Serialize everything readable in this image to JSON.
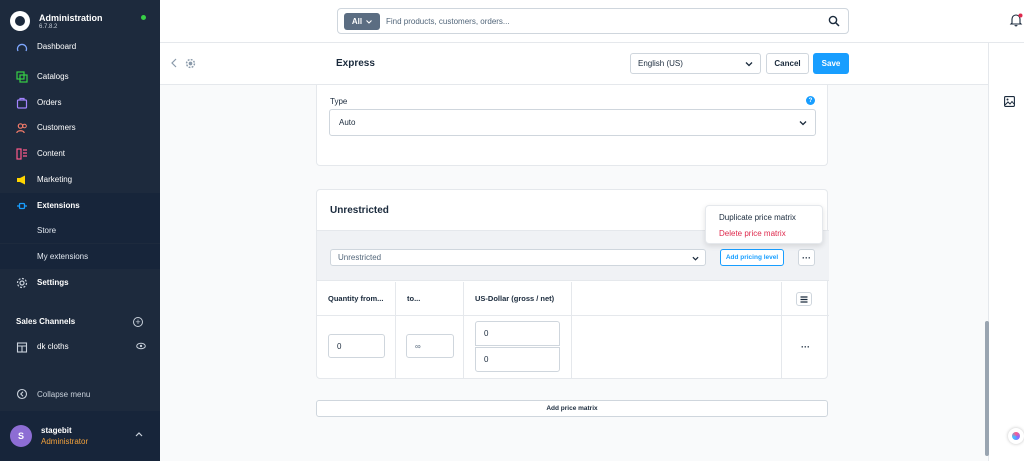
{
  "brand": {
    "name": "Administration",
    "version": "6.7.8.2"
  },
  "sidebar": {
    "items": [
      {
        "label": "Dashboard",
        "icon": "dashboard-icon"
      },
      {
        "label": "Catalogs",
        "icon": "catalog-icon"
      },
      {
        "label": "Orders",
        "icon": "orders-icon"
      },
      {
        "label": "Customers",
        "icon": "customers-icon"
      },
      {
        "label": "Content",
        "icon": "content-icon"
      },
      {
        "label": "Marketing",
        "icon": "marketing-icon"
      },
      {
        "label": "Extensions",
        "icon": "extensions-icon",
        "active": true
      },
      {
        "label": "Store"
      },
      {
        "label": "My extensions"
      },
      {
        "label": "Settings",
        "icon": "settings-icon"
      }
    ],
    "sales_channels_title": "Sales Channels",
    "sales_channels": [
      {
        "label": "dk cloths"
      }
    ],
    "collapse_label": "Collapse menu",
    "user": {
      "initial": "S",
      "name": "stagebit",
      "role": "Administrator"
    }
  },
  "search": {
    "scope": "All",
    "placeholder": "Find products, customers, orders..."
  },
  "smartbar": {
    "title": "Express",
    "language": "English (US)",
    "cancel_label": "Cancel",
    "save_label": "Save"
  },
  "type_card": {
    "label": "Type",
    "value": "Auto"
  },
  "matrix": {
    "title": "Unrestricted",
    "rule_value": "Unrestricted",
    "add_level_label": "Add pricing level",
    "dots_label": "···",
    "columns": [
      "Quantity from...",
      "to...",
      "US-Dollar (gross / net)",
      ""
    ],
    "row": {
      "qty_from": "0",
      "qty_to": "∞",
      "gross": "0",
      "net": "0"
    },
    "row_dots": "···"
  },
  "context_menu": {
    "duplicate_label": "Duplicate price matrix",
    "delete_label": "Delete price matrix"
  },
  "add_matrix_label": "Add price matrix",
  "colors": {
    "sidebar_bg": "#1d2a3d",
    "accent": "#189eff",
    "danger": "#de294c",
    "online": "#37d046",
    "role": "#f2a13b"
  }
}
